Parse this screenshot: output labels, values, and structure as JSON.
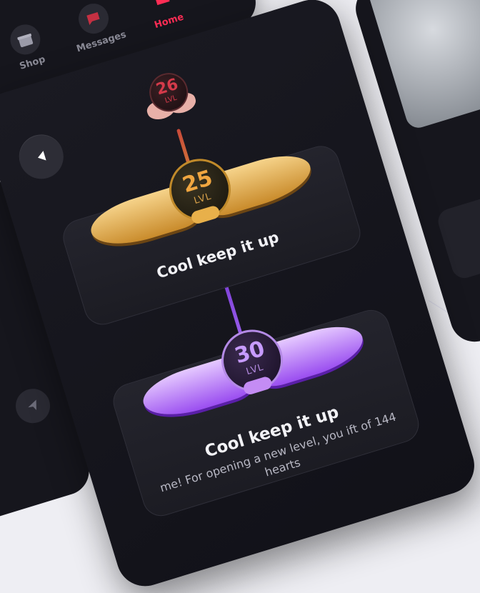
{
  "top_nav": {
    "tabs": [
      {
        "label": "Shop",
        "icon": "gift-icon"
      },
      {
        "label": "Messages",
        "icon": "message-icon"
      },
      {
        "label": "Home",
        "icon": "home-icon",
        "active": true
      }
    ]
  },
  "levels": {
    "previous": {
      "number": "26",
      "unit": "LVL"
    },
    "current": {
      "number": "25",
      "unit": "LVL",
      "message": "Cool keep it up"
    },
    "next": {
      "number": "30",
      "unit": "LVL",
      "message": "Cool keep it up",
      "description": "me! For opening a new level, you ift of 144 hearts"
    }
  },
  "colors": {
    "accent_red": "#ff2d55",
    "gold": "#f0a640",
    "purple": "#c79bff",
    "background": "#16161d"
  }
}
